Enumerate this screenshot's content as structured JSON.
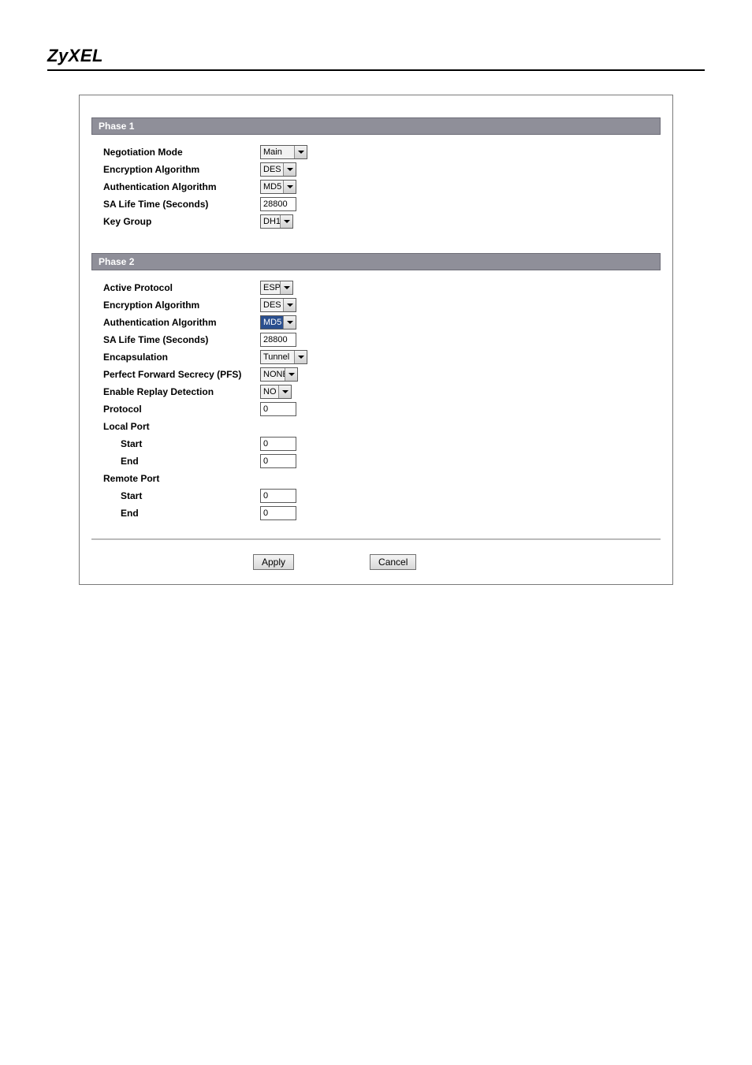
{
  "brand": "ZyXEL",
  "sections": {
    "phase1": {
      "title": "Phase 1",
      "negotiation_mode_label": "Negotiation Mode",
      "negotiation_mode_value": "Main",
      "encryption_label": "Encryption Algorithm",
      "encryption_value": "DES",
      "auth_label": "Authentication Algorithm",
      "auth_value": "MD5",
      "sa_life_label": "SA Life Time (Seconds)",
      "sa_life_value": "28800",
      "key_group_label": "Key Group",
      "key_group_value": "DH1"
    },
    "phase2": {
      "title": "Phase 2",
      "active_protocol_label": "Active Protocol",
      "active_protocol_value": "ESP",
      "encryption_label": "Encryption Algorithm",
      "encryption_value": "DES",
      "auth_label": "Authentication Algorithm",
      "auth_value": "MD5",
      "sa_life_label": "SA Life Time (Seconds)",
      "sa_life_value": "28800",
      "encapsulation_label": "Encapsulation",
      "encapsulation_value": "Tunnel",
      "pfs_label": "Perfect Forward Secrecy (PFS)",
      "pfs_value": "NONE",
      "replay_label": "Enable Replay Detection",
      "replay_value": "NO",
      "protocol_label": "Protocol",
      "protocol_value": "0",
      "local_port_label": "Local Port",
      "local_start_label": "Start",
      "local_start_value": "0",
      "local_end_label": "End",
      "local_end_value": "0",
      "remote_port_label": "Remote Port",
      "remote_start_label": "Start",
      "remote_start_value": "0",
      "remote_end_label": "End",
      "remote_end_value": "0"
    }
  },
  "buttons": {
    "apply": "Apply",
    "cancel": "Cancel"
  }
}
